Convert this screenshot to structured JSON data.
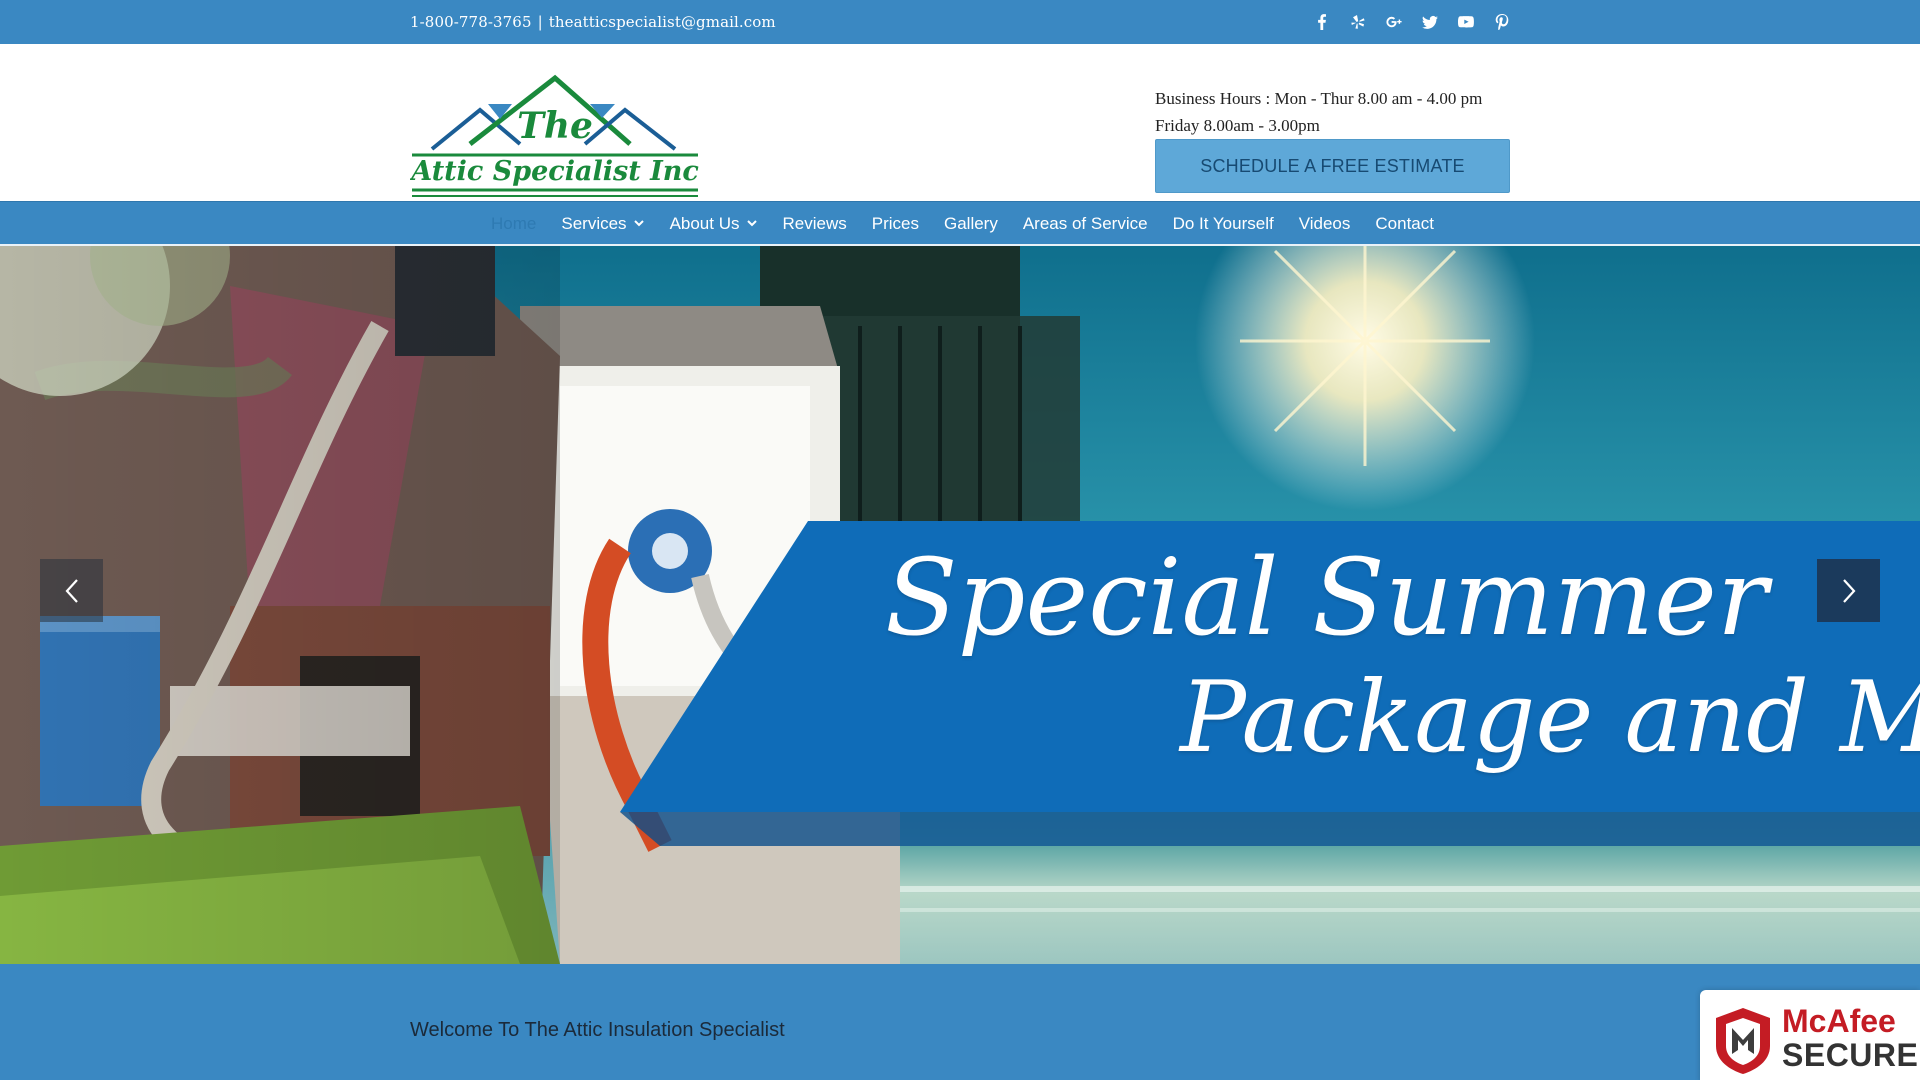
{
  "topbar": {
    "phone": "1-800-778-3765",
    "separator": "|",
    "email": "theatticspecialist@gmail.com",
    "social": [
      {
        "name": "facebook-icon"
      },
      {
        "name": "yelp-icon"
      },
      {
        "name": "google-plus-icon"
      },
      {
        "name": "twitter-icon"
      },
      {
        "name": "youtube-icon"
      },
      {
        "name": "pinterest-icon"
      }
    ]
  },
  "header": {
    "logo": {
      "line1": "The",
      "line2": "Attic Specialist Inc"
    },
    "hours_line1": "Business Hours : Mon - Thur 8.00 am - 4.00 pm",
    "hours_line2": "Friday 8.00am - 3.00pm",
    "cta_label": "SCHEDULE A FREE ESTIMATE"
  },
  "nav": {
    "items": [
      {
        "label": "Home",
        "active": true
      },
      {
        "label": "Services",
        "dropdown": true
      },
      {
        "label": "About Us",
        "dropdown": true
      },
      {
        "label": "Reviews"
      },
      {
        "label": "Prices"
      },
      {
        "label": "Gallery"
      },
      {
        "label": "Areas of Service"
      },
      {
        "label": "Do It Yourself"
      },
      {
        "label": "Videos"
      },
      {
        "label": "Contact"
      }
    ]
  },
  "hero": {
    "line1": "Special Summer",
    "line2": "Package and More"
  },
  "welcome": {
    "title": "Welcome To The Attic Insulation Specialist"
  },
  "badge": {
    "brand": "McAfee",
    "secure": "SECURE"
  },
  "colors": {
    "brand_blue": "#3a88c2",
    "banner_blue": "#0f6cb8",
    "logo_green": "#1a8a3c",
    "mcafee_red": "#c41c24"
  }
}
